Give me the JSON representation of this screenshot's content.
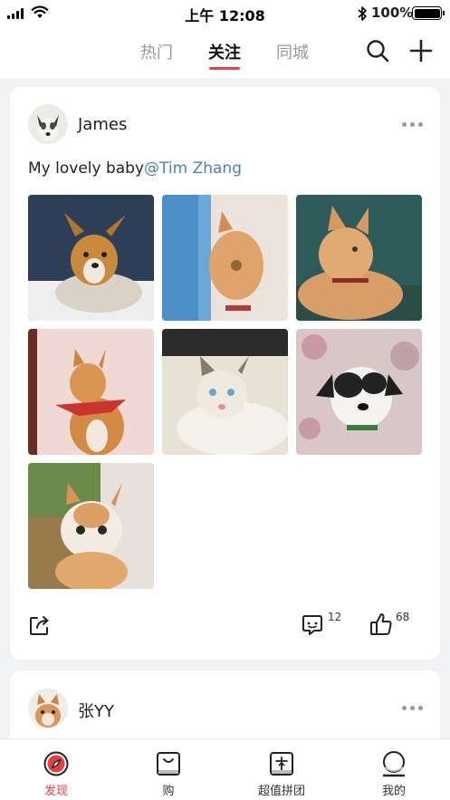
{
  "status_bar": {
    "time": "上午 12:08",
    "battery_pct": "100%",
    "bluetooth": "✱"
  },
  "nav": {
    "tabs": [
      {
        "label": "热门",
        "active": false
      },
      {
        "label": "关注",
        "active": true
      },
      {
        "label": "同城",
        "active": false
      }
    ],
    "accent_color": "#e8403f",
    "search_icon": "search-icon",
    "add_icon": "plus-icon"
  },
  "posts": [
    {
      "username": "James",
      "text": "My lovely baby",
      "mention": "@Tim Zhang",
      "photos": [
        "dog-puppy",
        "cat-orange-window",
        "cat-orange-lying",
        "cat-red-bandana",
        "cat-siamese",
        "dog-black-white",
        "cat-kitten-looking-up"
      ],
      "comment_count": "12",
      "like_count": "68"
    },
    {
      "username": "张YY"
    }
  ],
  "tab_bar": {
    "items": [
      {
        "label": "发现",
        "active": true,
        "icon": "compass-icon"
      },
      {
        "label": "购",
        "active": false,
        "icon": "shopping-bag-icon"
      },
      {
        "label": "超值拼团",
        "active": false,
        "icon": "group-buy-icon"
      },
      {
        "label": "我的",
        "active": false,
        "icon": "profile-icon"
      }
    ]
  }
}
